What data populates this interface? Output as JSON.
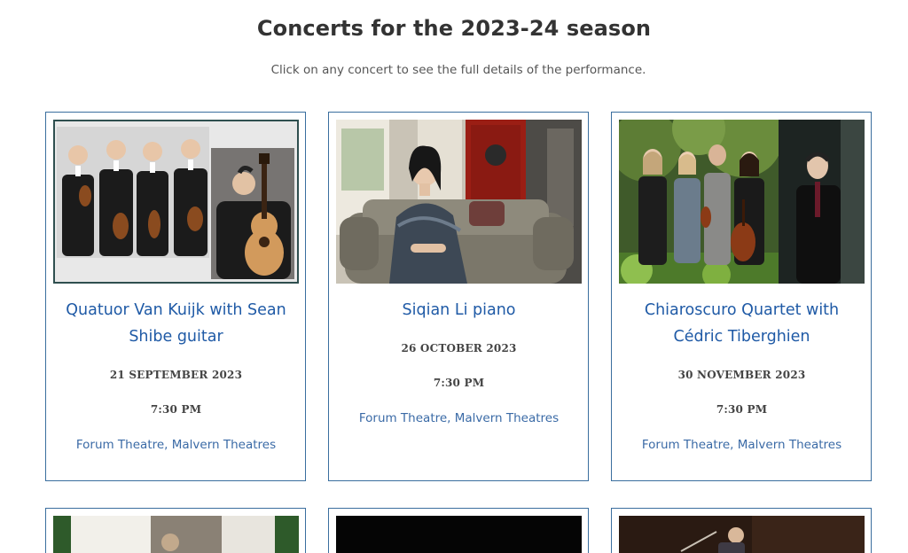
{
  "page": {
    "heading": "Concerts for the 2023-24 season",
    "subtitle": "Click on any concert to see the full details of the performance."
  },
  "concerts": [
    {
      "title": "Quatuor Van Kuijk with Sean Shibe guitar",
      "date": "21 SEPTEMBER 2023",
      "time": "7:30 PM",
      "venue": "Forum Theatre, Malvern Theatres"
    },
    {
      "title": "Siqian Li piano",
      "date": "26 OCTOBER 2023",
      "time": "7:30 PM",
      "venue": "Forum Theatre, Malvern Theatres"
    },
    {
      "title": "Chiaroscuro Quartet with Cédric Tiberghien",
      "date": "30 NOVEMBER 2023",
      "time": "7:30 PM",
      "venue": "Forum Theatre, Malvern Theatres"
    }
  ],
  "colors": {
    "accent": "#1f5aa6",
    "card_border": "#3a6e9e",
    "heading": "#333333"
  }
}
